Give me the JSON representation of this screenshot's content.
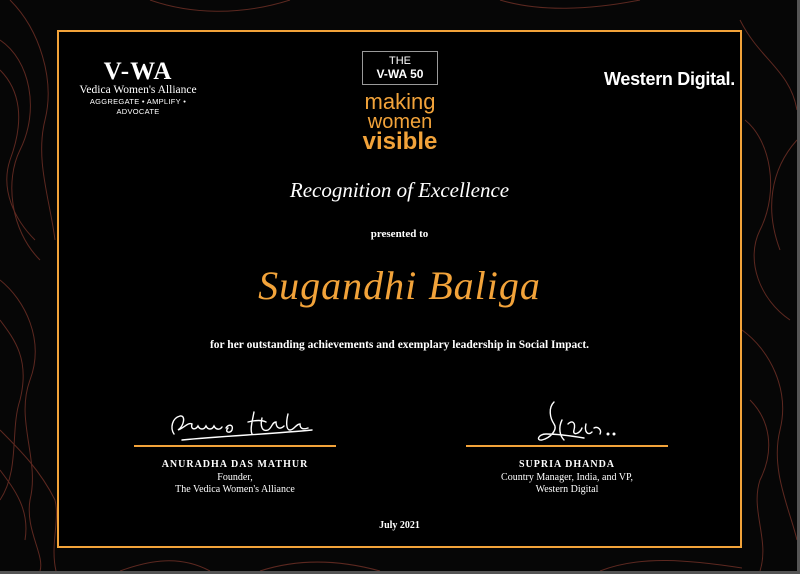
{
  "logos": {
    "vwa_mark": "V-WA",
    "vwa_name": "Vedica Women's Alliance",
    "vwa_tagline": "AGGREGATE • AMPLIFY • ADVOCATE",
    "vwa50_the": "THE",
    "vwa50_num": "V-WA 50",
    "campaign_line1": "making",
    "campaign_line2": "women",
    "campaign_line3": "visible",
    "sponsor": "Western Digital."
  },
  "certificate": {
    "title": "Recognition of Excellence",
    "presented_to": "presented to",
    "recipient": "Sugandhi Baliga",
    "citation": "for her outstanding achievements and exemplary leadership in Social Impact.",
    "date": "July 2021"
  },
  "signatories": [
    {
      "name": "ANURADHA DAS MATHUR",
      "title_line1": "Founder,",
      "title_line2": "The Vedica Women's Alliance"
    },
    {
      "name": "SUPRIA DHANDA",
      "title_line1": "Country Manager, India, and VP,",
      "title_line2": "Western Digital"
    }
  ],
  "colors": {
    "accent": "#f2a33a",
    "background": "#000000",
    "text": "#ffffff",
    "contour": "#8a3a2e"
  }
}
